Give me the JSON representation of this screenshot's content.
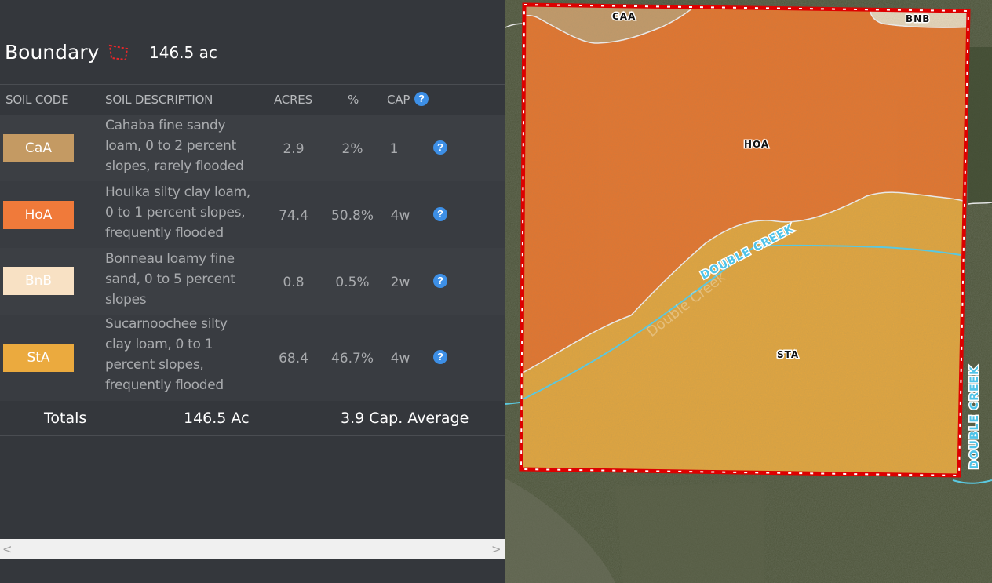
{
  "boundary": {
    "title": "Boundary",
    "icon": "boundary-polygon-icon",
    "acres": "146.5 ac"
  },
  "table": {
    "headers": {
      "soil_code": "SOIL CODE",
      "soil_description": "SOIL DESCRIPTION",
      "acres": "ACRES",
      "percent": "%",
      "cap": "CAP"
    },
    "rows": [
      {
        "code": "CaA",
        "color": "#c49a63",
        "description": "Cahaba fine sandy loam, 0 to 2 percent slopes, rarely flooded",
        "acres": "2.9",
        "percent": "2%",
        "cap": "1"
      },
      {
        "code": "HoA",
        "color": "#f07a3a",
        "description": "Houlka silty clay loam, 0 to 1 percent slopes, frequently flooded",
        "acres": "74.4",
        "percent": "50.8%",
        "cap": "4w"
      },
      {
        "code": "BnB",
        "color": "#f8e1c4",
        "description": "Bonneau loamy fine sand, 0 to 5 percent slopes",
        "acres": "0.8",
        "percent": "0.5%",
        "cap": "2w"
      },
      {
        "code": "StA",
        "color": "#ebaa3e",
        "description": "Sucarnoochee silty clay loam, 0 to 1 percent slopes, frequently flooded",
        "acres": "68.4",
        "percent": "46.7%",
        "cap": "4w"
      }
    ],
    "help_symbol": "?"
  },
  "totals": {
    "label": "Totals",
    "acres": "146.5 Ac",
    "cap_average": "3.9 Cap. Average"
  },
  "scrollbar": {
    "left": "<",
    "right": ">"
  },
  "map": {
    "labels": {
      "caa": "CAA",
      "bnb": "BNB",
      "hoa": "HOA",
      "sta": "STA"
    },
    "creek_label": "DOUBLE CREEK",
    "creek_name_faint": "Double Creek",
    "boundary_color": "#e00000"
  }
}
